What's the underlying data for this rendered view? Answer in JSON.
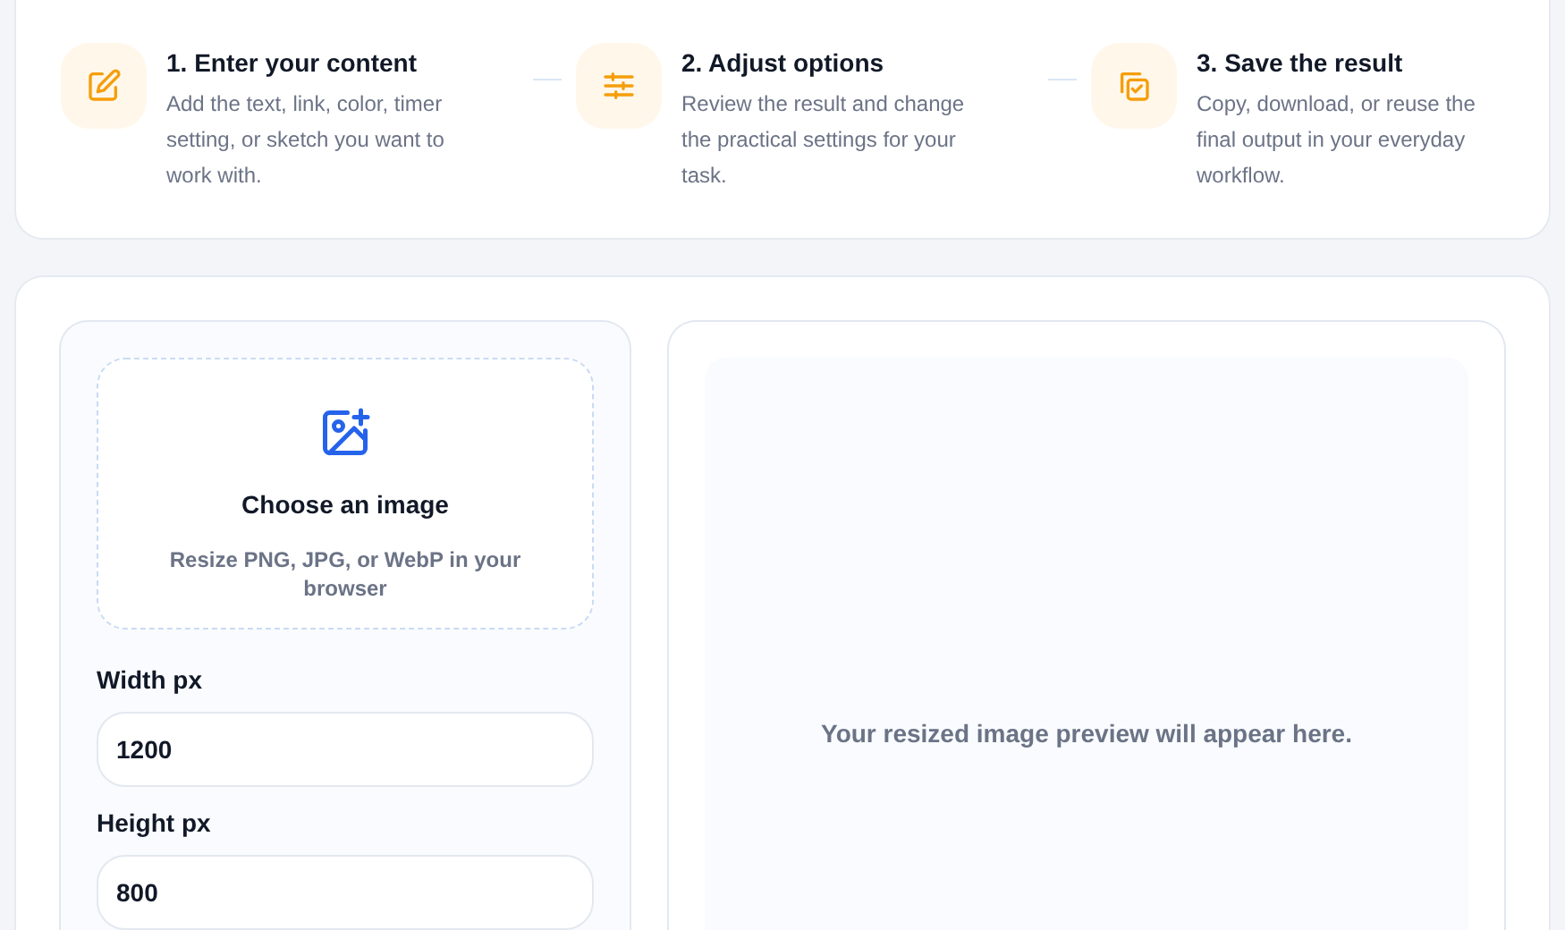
{
  "steps": [
    {
      "title": "1. Enter your content",
      "description": "Add the text, link, color, timer setting, or sketch you want to work with."
    },
    {
      "title": "2. Adjust options",
      "description": "Review the result and change the practical settings for your task."
    },
    {
      "title": "3. Save the result",
      "description": "Copy, download, or reuse the final output in your everyday workflow."
    }
  ],
  "upload": {
    "title": "Choose an image",
    "hint": "Resize PNG, JPG, or WebP in your browser"
  },
  "fields": [
    {
      "label": "Width px",
      "value": "1200"
    },
    {
      "label": "Height px",
      "value": "800"
    }
  ],
  "preview": {
    "empty_message": "Your resized image preview will appear here."
  }
}
